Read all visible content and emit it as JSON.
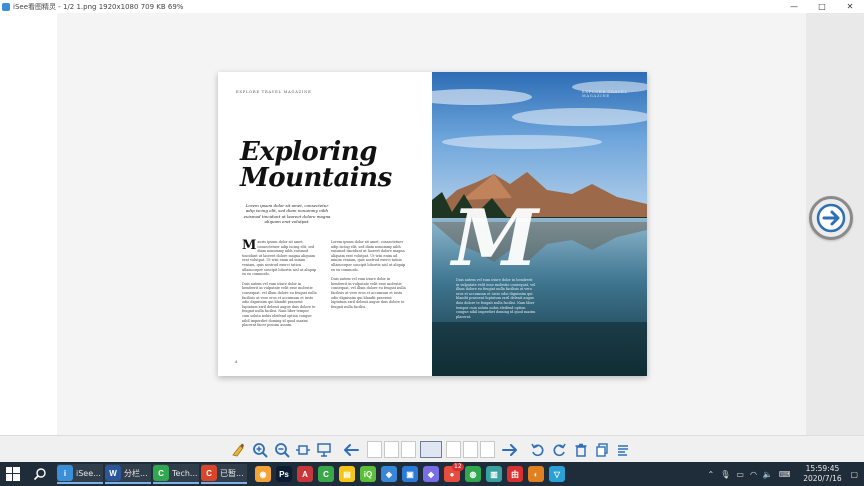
{
  "window": {
    "title": "iSee看图精灵 - 1/2  1.png  1920x1080  709 KB  69%",
    "controls": {
      "minimize": "—",
      "maximize": "□",
      "close": "✕"
    }
  },
  "magazine": {
    "name": "EXPLORE TRAVEL MAGAZINE",
    "headline_line1": "Exploring",
    "headline_line2": "Mountains",
    "subhead": "Lorem ipsum dolor sit amet, consectetur adip iscing elit, sed diam nonummy nibh euismod tincidunt ut laoreet dolore magna aliquam erat volutpat.",
    "dropcap": "M",
    "col1_p1": "auris ipsum dolor sit amet, consectetuer adip iscing elit, sed diam nonummy nibh euismod tincidunt ut laoreet dolore magna aliquam erat volutpat. Ut wisi enim ad minim veniam, quis nostrud exerci tation ullamcorper suscipit lobortis nisl ut aliquip ex ea commodo.",
    "col1_p2": "Duis autem vel eum iriure dolor in hendrerit in vulputate velit esse molestie consequat, vel illum dolore eu feugiat nulla facilisis at vero eros et accumsan et iusto odio dignissim qui blandit praesent luptatum zzril delenit augue duis dolore te feugait nulla facilisi. Nam liber tempor cum soluta nobis eleifend option congue nihil imperdiet doming id quod mazim placerat facer possim assum.",
    "col2_p1": "Lorem ipsum dolor sit amet, consectetuer adip iscing elit, sed diam nonummy nibh euismod tincidunt ut laoreet dolore magna aliquam erat volutpat. Ut wisi enim ad minim veniam, quis nostrud exerci tation ullamcorper suscipit lobortis nisl ut aliquip ex ea commodo.",
    "col2_p2": "Duis autem vel eum iriure dolor in hendrerit in vulputate velit esse molestie consequat, vel illum dolore eu feugiat nulla facilisis at vero eros et accumsan et iusto odio dignissim qui blandit praesent luptatum zzril delenit augue duis dolore te feugait nulla facilisi.",
    "page_number": "4",
    "big_letter": "M",
    "right_text": "Duis autem vel eum iriure dolor in hendrerit in vulputate velit esse molestie consequat, vel illum dolore eu feugiat nulla facilisis at vero eros et accumsan et iusto odio dignissim qui blandit praesent luptatum zzril delenit augue duis dolore te feugait nulla facilisi. Nam liber tempor cum soluta nobis eleifend option congue nihil imperdiet doming id quod mazim placerat."
  },
  "toolbar": {
    "icons": [
      "clean-icon",
      "zoom-in-icon",
      "zoom-out-icon",
      "fit-icon",
      "slideshow-icon",
      "prev-icon",
      "next-icon",
      "rotate-left-icon",
      "rotate-right-icon",
      "delete-icon",
      "copy-icon",
      "info-icon"
    ]
  },
  "taskbar": {
    "apps": [
      {
        "label": "iSee...",
        "color": "#3a8fd6",
        "glyph": "i"
      },
      {
        "label": "分栏...",
        "color": "#2b579a",
        "glyph": "W"
      },
      {
        "label": "Tech...",
        "color": "#2fa84f",
        "glyph": "C"
      },
      {
        "label": "已暂...",
        "color": "#d9452b",
        "glyph": "C"
      }
    ],
    "pinned": [
      {
        "color": "#f2a33a",
        "glyph": "◉"
      },
      {
        "color": "#0c1c33",
        "glyph": "Ps"
      },
      {
        "color": "#c8383a",
        "glyph": "A"
      },
      {
        "color": "#3aa84a",
        "glyph": "C"
      },
      {
        "color": "#f5c518",
        "glyph": "▤"
      },
      {
        "color": "#5bbf3a",
        "glyph": "iQ"
      },
      {
        "color": "#3a86d6",
        "glyph": "◈"
      },
      {
        "color": "#2a7ad6",
        "glyph": "▣"
      },
      {
        "color": "#7a6ee6",
        "glyph": "◆"
      },
      {
        "color": "#e74c3c",
        "glyph": "●"
      },
      {
        "color": "#2fa84f",
        "glyph": "◍"
      },
      {
        "color": "#3aa0a0",
        "glyph": "▥"
      },
      {
        "color": "#d93030",
        "glyph": "由"
      },
      {
        "color": "#e08020",
        "glyph": "◐"
      },
      {
        "color": "#2aa0d6",
        "glyph": "▽"
      }
    ],
    "time": "15:59:45",
    "date": "2020/7/16",
    "tray_badge": "12"
  }
}
